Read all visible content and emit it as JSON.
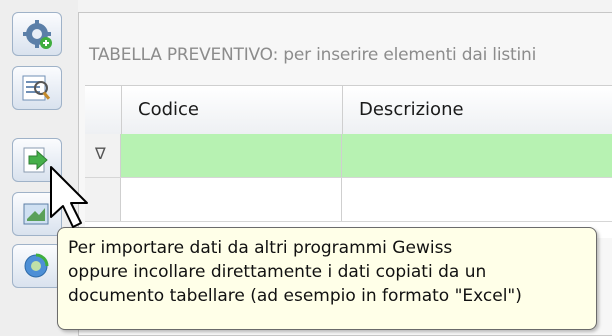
{
  "toolbar": {
    "buttons": [
      {
        "name": "settings-gear-icon"
      },
      {
        "name": "search-list-icon"
      },
      {
        "name": "import-arrow-icon"
      },
      {
        "name": "export-icon"
      },
      {
        "name": "refresh-icon"
      }
    ]
  },
  "panel": {
    "caption": "TABELLA PREVENTIVO: per inserire elementi dai listini"
  },
  "grid": {
    "columns": [
      "Codice",
      "Descrizione"
    ],
    "new_row_glyph": "∇"
  },
  "tooltip": {
    "lines": [
      "Per importare dati da altri programmi Gewiss",
      "oppure incollare direttamente i dati copiati da un",
      "documento tabellare (ad esempio in formato \"Excel\")"
    ]
  },
  "colors": {
    "active_row": "#b7f2b2",
    "tooltip_bg": "#ffffe8"
  }
}
